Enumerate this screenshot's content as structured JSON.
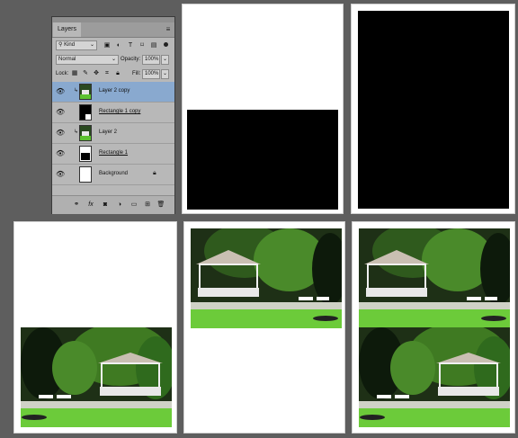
{
  "layers_panel": {
    "tab_label": "Layers",
    "menu_icon": "panel-menu-icon",
    "filter": {
      "value": "Kind",
      "icons": [
        "image-filter-icon",
        "adjustment-filter-icon",
        "type-filter-icon",
        "shape-filter-icon",
        "smart-object-filter-icon"
      ]
    },
    "blend_mode": "Normal",
    "opacity_label": "Opacity:",
    "opacity_value": "100%",
    "lock_label": "Lock:",
    "fill_label": "Fill:",
    "fill_value": "100%",
    "layers": [
      {
        "name": "Layer 2 copy",
        "selected": true,
        "thumb": "photo",
        "clipped": true
      },
      {
        "name": "Rectangle 1 copy",
        "selected": false,
        "thumb": "black",
        "clipped": false
      },
      {
        "name": "Layer 2",
        "selected": false,
        "thumb": "photo",
        "clipped": true
      },
      {
        "name": "Rectangle 1",
        "selected": false,
        "thumb": "white-black",
        "clipped": false
      },
      {
        "name": "Background",
        "selected": false,
        "thumb": "white",
        "clipped": false
      }
    ],
    "bottom_icons": [
      "link-icon",
      "fx-icon",
      "mask-icon",
      "adjustment-icon",
      "folder-icon",
      "new-layer-icon",
      "trash-icon"
    ]
  },
  "colors": {
    "photo_sky": "#1d2a1a",
    "grass": "#5cc22f",
    "gazebo": "#f0f0f0"
  }
}
